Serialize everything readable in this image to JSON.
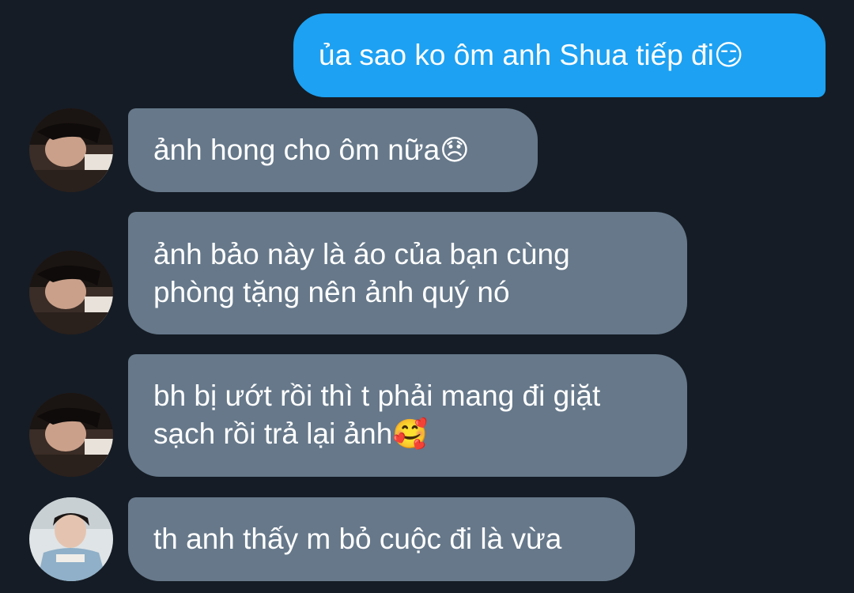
{
  "conversation": {
    "messages": [
      {
        "sender": "me",
        "text": "ủa sao ko ôm anh Shua tiếp đi",
        "emoji": "😏"
      },
      {
        "sender": "other",
        "text": "ảnh hong cho ôm nữa",
        "emoji": "😞"
      },
      {
        "sender": "other",
        "line1": "ảnh bảo này là áo của bạn cùng",
        "line2": "phòng tặng nên ảnh quý nó"
      },
      {
        "sender": "other",
        "line1": "bh bị ướt rồi thì t phải mang đi giặt",
        "line2": "sạch rồi trả lại ảnh",
        "emoji": "🥰"
      },
      {
        "sender": "other-2",
        "text": "th anh thấy m bỏ cuộc đi là vừa"
      }
    ]
  },
  "colors": {
    "background": "#151c25",
    "sent_bubble": "#1da1f2",
    "received_bubble": "#66788a",
    "text": "#ffffff"
  },
  "icons": {
    "avatar_1": "avatar-photo-boy-dark-hair",
    "avatar_2": "avatar-photo-boy-blue-jacket"
  }
}
